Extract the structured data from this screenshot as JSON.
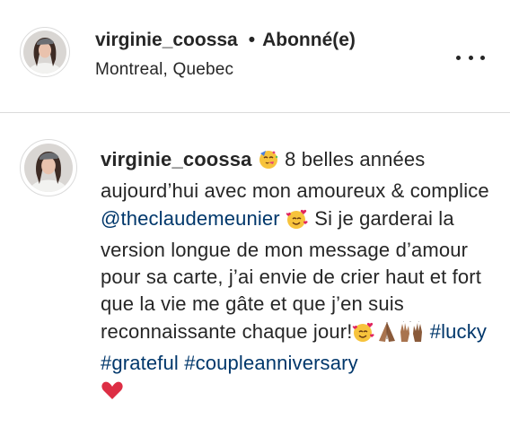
{
  "header": {
    "username": "virginie_coossa",
    "separator": "•",
    "follow_status": "Abonné(e)",
    "location": "Montreal, Quebec"
  },
  "post": {
    "username": "virginie_coossa",
    "text_1": " 8 belles années aujourd’hui avec mon amoureux & complice ",
    "mention": "@theclaudemeunier",
    "text_2": " Si je garderai la version longue de mon message d’amour pour sa carte, j’ai envie de crier haut et fort que la vie me gâte et que j’en suis reconnaissante chaque jour!",
    "hashtags": [
      "#lucky",
      "#grateful",
      "#coupleanniversary"
    ]
  },
  "icons": {
    "more": "more-options-icon",
    "emojis": [
      "party-face-emoji",
      "smiling-face-with-hearts-emoji",
      "smiling-face-with-hearts-emoji",
      "folded-hands-emoji",
      "raising-hands-emoji",
      "red-heart-emoji"
    ]
  }
}
